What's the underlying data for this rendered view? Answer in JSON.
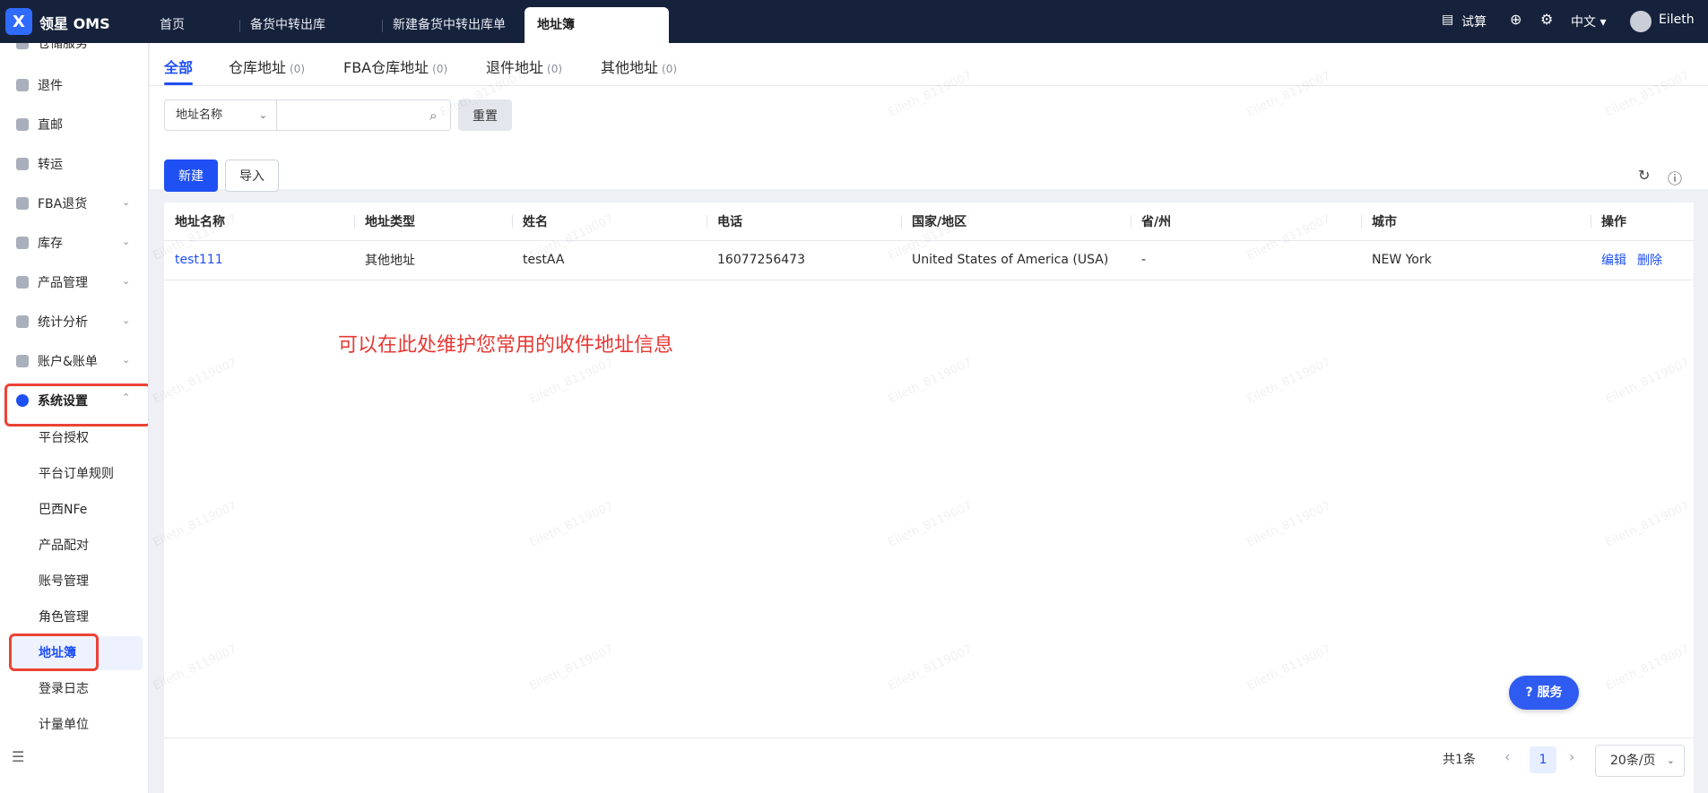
{
  "app": {
    "brand": "领星 OMS",
    "logo_glyph": "X"
  },
  "tabs": [
    {
      "label": "首页"
    },
    {
      "label": "备货中转出库"
    },
    {
      "label": "新建备货中转出库单"
    },
    {
      "label": "地址簿"
    }
  ],
  "topright": {
    "calc_label": "试算",
    "lang": "中文",
    "user": "Eileth"
  },
  "sidebar": {
    "partial_item": "仓储服务",
    "items": [
      {
        "label": "退件"
      },
      {
        "label": "直邮"
      },
      {
        "label": "转运"
      },
      {
        "label": "FBA退货"
      },
      {
        "label": "库存"
      },
      {
        "label": "产品管理"
      },
      {
        "label": "统计分析"
      },
      {
        "label": "账户&账单"
      },
      {
        "label": "系统设置"
      }
    ],
    "subitems": [
      {
        "label": "平台授权"
      },
      {
        "label": "平台订单规则"
      },
      {
        "label": "巴西NFe"
      },
      {
        "label": "产品配对"
      },
      {
        "label": "账号管理"
      },
      {
        "label": "角色管理"
      },
      {
        "label": "地址簿"
      },
      {
        "label": "登录日志"
      },
      {
        "label": "计量单位"
      }
    ]
  },
  "subtabs": [
    {
      "label": "全部",
      "count": ""
    },
    {
      "label": "仓库地址",
      "count": "(0)"
    },
    {
      "label": "FBA仓库地址",
      "count": "(0)"
    },
    {
      "label": "退件地址",
      "count": "(0)"
    },
    {
      "label": "其他地址",
      "count": "(0)"
    }
  ],
  "filter": {
    "select_value": "地址名称",
    "search_placeholder": "",
    "reset_label": "重置"
  },
  "actions": {
    "new_label": "新建",
    "import_label": "导入"
  },
  "table": {
    "headers": [
      "地址名称",
      "地址类型",
      "姓名",
      "电话",
      "国家/地区",
      "省/州",
      "城市",
      "操作"
    ],
    "rows": [
      {
        "name": "test111",
        "type": "其他地址",
        "person": "testAA",
        "phone": "16077256473",
        "country": "United States of America (USA)",
        "state": "-",
        "city": "NEW York",
        "edit": "编辑",
        "delete": "删除"
      }
    ]
  },
  "annotation": "可以在此处维护您常用的收件地址信息",
  "pagination": {
    "total": "共1条",
    "current_page": "1",
    "page_size": "20条/页"
  },
  "service_label": "服务",
  "watermark": "Eileth_8119007",
  "colors": {
    "topbar": "#16223b",
    "primary": "#1f50f3",
    "highlight_box": "#ea4335",
    "note_text": "#e53935"
  }
}
